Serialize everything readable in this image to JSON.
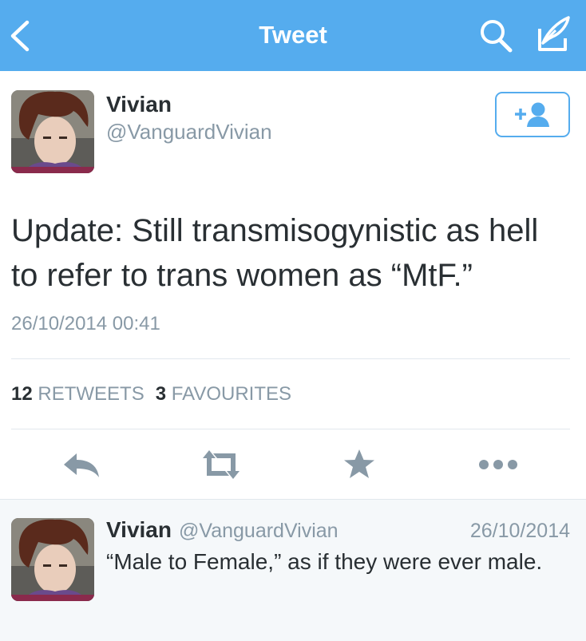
{
  "navbar": {
    "title": "Tweet",
    "back_icon": "chevron-left-icon",
    "search_icon": "search-icon",
    "compose_icon": "compose-icon",
    "background": "#55acee"
  },
  "tweet": {
    "author_name": "Vivian",
    "author_handle": "@VanguardVivian",
    "follow_icon": "add-user-icon",
    "text": "Update: Still transmisogynistic as hell to refer to trans women as “MtF.”",
    "timestamp": "26/10/2014 00:41",
    "stats": {
      "retweets_count": "12",
      "retweets_label": "RETWEETS",
      "favourites_count": "3",
      "favourites_label": "FAVOURITES"
    },
    "actions": [
      "reply-icon",
      "retweet-icon",
      "favourite-icon",
      "more-icon"
    ]
  },
  "reply": {
    "author_name": "Vivian",
    "author_handle": "@VanguardVivian",
    "date": "26/10/2014",
    "text": "“Male to Female,” as if they were ever male."
  },
  "colors": {
    "accent": "#55acee",
    "text": "#292f33",
    "muted": "#8899a6",
    "icon": "#8899a6",
    "divider": "#e1e8ed",
    "reply_bg": "#f5f8fa"
  }
}
